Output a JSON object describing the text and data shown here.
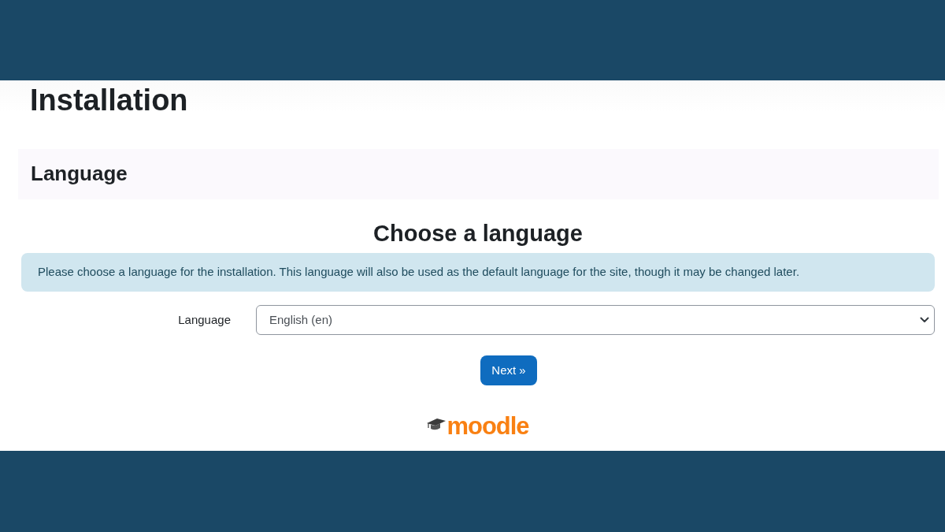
{
  "page_title": "Installation",
  "section": {
    "title": "Language"
  },
  "heading": "Choose a language",
  "alert": {
    "text": "Please choose a language for the installation. This language will also be used as the default language for the site, though it may be changed later."
  },
  "form": {
    "fields": [
      {
        "kind": "select",
        "label": "Language",
        "value": "English (en)"
      }
    ]
  },
  "next_button": {
    "label": "Next »"
  },
  "logo": {
    "text": "moodle"
  }
}
